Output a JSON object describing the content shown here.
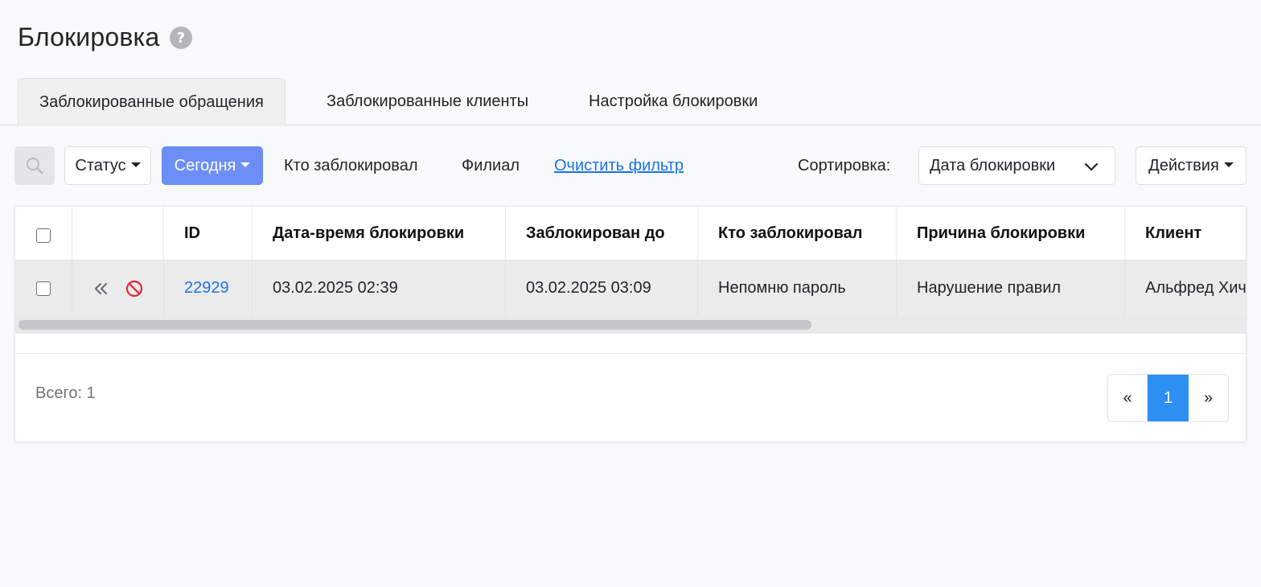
{
  "page": {
    "title": "Блокировка",
    "help_icon": "question-circle-icon"
  },
  "tabs": [
    {
      "label": "Заблокированные обращения",
      "active": true
    },
    {
      "label": "Заблокированные клиенты",
      "active": false
    },
    {
      "label": "Настройка блокировки",
      "active": false
    }
  ],
  "filters": {
    "search_icon": "search-icon",
    "status_label": "Статус",
    "date_label": "Сегодня",
    "who_label": "Кто заблокировал",
    "branch_label": "Филиал",
    "clear_label": "Очистить фильтр",
    "sort_label": "Сортировка:",
    "sort_value": "Дата блокировки",
    "actions_label": "Действия"
  },
  "table": {
    "columns": [
      "",
      "",
      "ID",
      "Дата-время блокировки",
      "Заблокирован до",
      "Кто заблокировал",
      "Причина блокировки",
      "Клиент"
    ],
    "rows": [
      {
        "checked": false,
        "icons": [
          "double-chevron-left-icon",
          "block-icon"
        ],
        "id": "22929",
        "blocked_at": "03.02.2025 02:39",
        "blocked_until": "03.02.2025 03:09",
        "who": "Непомню пароль",
        "reason": "Нарушение правил",
        "client": "Альфред Хичкок"
      }
    ]
  },
  "footer": {
    "total": "Всего: 1"
  },
  "pagination": {
    "prev": "«",
    "current": "1",
    "next": "»"
  },
  "colors": {
    "accent": "#6c8ef6",
    "link": "#1a73e8",
    "page_active": "#2d8ff2",
    "danger_icon": "#e0283a"
  }
}
